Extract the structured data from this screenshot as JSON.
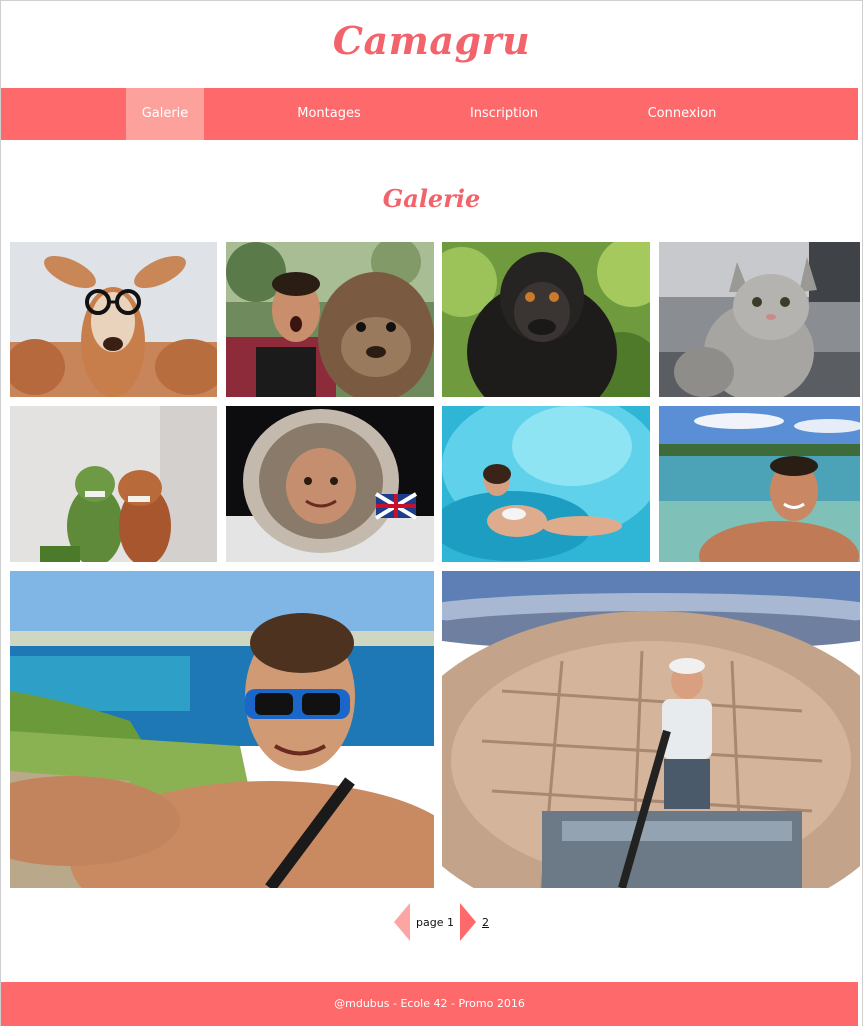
{
  "site": {
    "title": "Camagru"
  },
  "nav": {
    "items": [
      {
        "label": "Galerie",
        "active": true
      },
      {
        "label": "Montages",
        "active": false
      },
      {
        "label": "Inscription",
        "active": false
      },
      {
        "label": "Connexion",
        "active": false
      }
    ]
  },
  "gallery": {
    "title": "Galerie",
    "photos": [
      {
        "subject": "deer-with-glasses"
      },
      {
        "subject": "man-with-quokka"
      },
      {
        "subject": "macaque-selfie"
      },
      {
        "subject": "cat-selfie"
      },
      {
        "subject": "toy-dinosaurs"
      },
      {
        "subject": "astronaut-selfie"
      },
      {
        "subject": "woman-in-waterslide"
      },
      {
        "subject": "man-at-lake"
      },
      {
        "subject": "man-with-sunglasses-at-beach"
      },
      {
        "subject": "man-on-rooftop-over-city"
      }
    ]
  },
  "pagination": {
    "current_label": "page 1",
    "next_page_label": "2"
  },
  "footer": {
    "text": "@mdubus - Ecole 42 - Promo 2016"
  },
  "colors": {
    "brand": "#fe6a6b",
    "title": "#f2636b",
    "nav_active": "#fda19c",
    "pager_prev": "#fca6a4"
  }
}
